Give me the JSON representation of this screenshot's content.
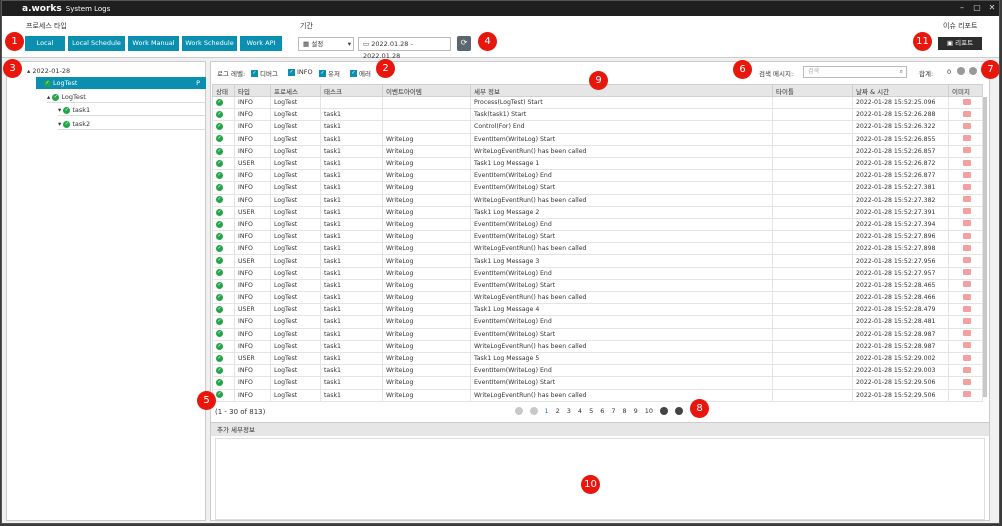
{
  "app": {
    "logo": "a.works",
    "title": "System Logs"
  },
  "toolbar": {
    "process_type_label": "프로세스 타입",
    "process_buttons": [
      "Local",
      "Local Schedule",
      "Work Manual",
      "Work Schedule",
      "Work API"
    ],
    "period_label": "기간",
    "combo_value": "설정",
    "date_range": "2022.01.28 - 2022.01.28",
    "issue_report_label": "이슈 리포트",
    "report_button": "리포트"
  },
  "tree": {
    "date": "2022-01-28",
    "root": "LogTest",
    "root_tag": "P",
    "child": "LogTest",
    "tasks": [
      "task1",
      "task2"
    ]
  },
  "filters": {
    "label": "로그 레벨:",
    "items": [
      "디버그",
      "INFO",
      "유저",
      "에러"
    ],
    "search_label": "검색 메시지:",
    "search_placeholder": "검색",
    "total_label": "합계:",
    "total_value": "0"
  },
  "grid": {
    "columns": [
      "상태",
      "타입",
      "프로세스",
      "태스크",
      "이벤트아이템",
      "세부 정보",
      "타이틀",
      "날짜 & 시간",
      "이미지"
    ],
    "rows": [
      [
        "INFO",
        "LogTest",
        "",
        "",
        "Process(LogTest) Start",
        "",
        "2022-01-28 15:52:25.096"
      ],
      [
        "INFO",
        "LogTest",
        "task1",
        "",
        "Task(task1) Start",
        "",
        "2022-01-28 15:52:26.288"
      ],
      [
        "INFO",
        "LogTest",
        "task1",
        "",
        "Control(For) End",
        "",
        "2022-01-28 15:52:26.322"
      ],
      [
        "INFO",
        "LogTest",
        "task1",
        "WriteLog",
        "EventItem(WriteLog) Start",
        "",
        "2022-01-28 15:52:26.855"
      ],
      [
        "INFO",
        "LogTest",
        "task1",
        "WriteLog",
        "WriteLogEventRun() has been called",
        "",
        "2022-01-28 15:52:26.857"
      ],
      [
        "USER",
        "LogTest",
        "task1",
        "WriteLog",
        "Task1 Log Message 1",
        "",
        "2022-01-28 15:52:26.872"
      ],
      [
        "INFO",
        "LogTest",
        "task1",
        "WriteLog",
        "EventItem(WriteLog) End",
        "",
        "2022-01-28 15:52:26.877"
      ],
      [
        "INFO",
        "LogTest",
        "task1",
        "WriteLog",
        "EventItem(WriteLog) Start",
        "",
        "2022-01-28 15:52:27.381"
      ],
      [
        "INFO",
        "LogTest",
        "task1",
        "WriteLog",
        "WriteLogEventRun() has been called",
        "",
        "2022-01-28 15:52:27.382"
      ],
      [
        "USER",
        "LogTest",
        "task1",
        "WriteLog",
        "Task1 Log Message 2",
        "",
        "2022-01-28 15:52:27.391"
      ],
      [
        "INFO",
        "LogTest",
        "task1",
        "WriteLog",
        "EventItem(WriteLog) End",
        "",
        "2022-01-28 15:52:27.394"
      ],
      [
        "INFO",
        "LogTest",
        "task1",
        "WriteLog",
        "EventItem(WriteLog) Start",
        "",
        "2022-01-28 15:52:27.896"
      ],
      [
        "INFO",
        "LogTest",
        "task1",
        "WriteLog",
        "WriteLogEventRun() has been called",
        "",
        "2022-01-28 15:52:27.898"
      ],
      [
        "USER",
        "LogTest",
        "task1",
        "WriteLog",
        "Task1 Log Message 3",
        "",
        "2022-01-28 15:52:27.956"
      ],
      [
        "INFO",
        "LogTest",
        "task1",
        "WriteLog",
        "EventItem(WriteLog) End",
        "",
        "2022-01-28 15:52:27.957"
      ],
      [
        "INFO",
        "LogTest",
        "task1",
        "WriteLog",
        "EventItem(WriteLog) Start",
        "",
        "2022-01-28 15:52:28.465"
      ],
      [
        "INFO",
        "LogTest",
        "task1",
        "WriteLog",
        "WriteLogEventRun() has been called",
        "",
        "2022-01-28 15:52:28.466"
      ],
      [
        "USER",
        "LogTest",
        "task1",
        "WriteLog",
        "Task1 Log Message 4",
        "",
        "2022-01-28 15:52:28.479"
      ],
      [
        "INFO",
        "LogTest",
        "task1",
        "WriteLog",
        "EventItem(WriteLog) End",
        "",
        "2022-01-28 15:52:28.481"
      ],
      [
        "INFO",
        "LogTest",
        "task1",
        "WriteLog",
        "EventItem(WriteLog) Start",
        "",
        "2022-01-28 15:52:28.987"
      ],
      [
        "INFO",
        "LogTest",
        "task1",
        "WriteLog",
        "WriteLogEventRun() has been called",
        "",
        "2022-01-28 15:52:28.987"
      ],
      [
        "USER",
        "LogTest",
        "task1",
        "WriteLog",
        "Task1 Log Message 5",
        "",
        "2022-01-28 15:52:29.002"
      ],
      [
        "INFO",
        "LogTest",
        "task1",
        "WriteLog",
        "EventItem(WriteLog) End",
        "",
        "2022-01-28 15:52:29.003"
      ],
      [
        "INFO",
        "LogTest",
        "task1",
        "WriteLog",
        "EventItem(WriteLog) Start",
        "",
        "2022-01-28 15:52:29.506"
      ],
      [
        "INFO",
        "LogTest",
        "task1",
        "WriteLog",
        "WriteLogEventRun() has been called",
        "",
        "2022-01-28 15:52:29.506"
      ]
    ]
  },
  "pagination": {
    "summary": "(1 - 30 of 813)",
    "pages": [
      "1",
      "2",
      "3",
      "4",
      "5",
      "6",
      "7",
      "8",
      "9",
      "10"
    ]
  },
  "detail": {
    "title": "추가 세부정보"
  },
  "badges": [
    "1",
    "2",
    "3",
    "4",
    "5",
    "6",
    "7",
    "8",
    "9",
    "10",
    "11"
  ],
  "colors": {
    "accent": "#0b8fb0",
    "badge": "#e8160c",
    "status_ok": "#22a447"
  }
}
